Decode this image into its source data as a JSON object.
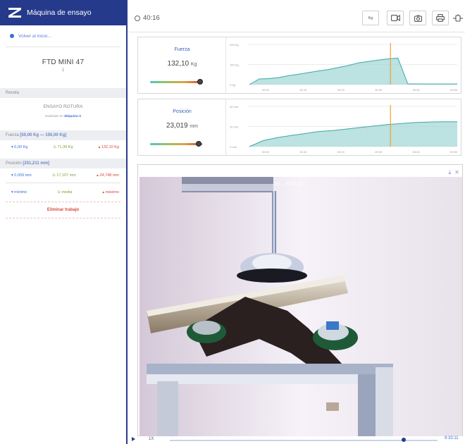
{
  "app": {
    "title": "Máquina de ensayo"
  },
  "sidebar": {
    "back": "Volver al inicio...",
    "machine_name": "FTD MINI 47",
    "machine_number": "1",
    "recipe_label": "Receta",
    "recipe_name": "ENSAYO ROTURA",
    "performed_prefix": "realizado en",
    "performed_machine": "Máquina A",
    "force_label": "Fuerza",
    "force_range": "[50,00 Kg — 150,00 Kg]",
    "force_min": "0,00 Kg",
    "force_avg": "71,36 Kg",
    "force_max": "132,10 Kg",
    "position_label": "Posición",
    "position_range": "[251,211 mm]",
    "position_min": "0,009 mm",
    "position_avg": "17,107 mm",
    "position_max": "24,748 mm",
    "legend_min": "mínimo",
    "legend_avg": "media",
    "legend_max": "máximo",
    "delete": "Eliminar trabajo"
  },
  "topbar": {
    "timer": "40:16",
    "unit_button": "Kg"
  },
  "force_panel": {
    "label": "Fuerza",
    "value": "132,10",
    "unit": "Kg",
    "level": 0.96
  },
  "position_panel": {
    "label": "Posición",
    "value": "23,019",
    "unit": "mm",
    "level": 0.93
  },
  "chart_data": [
    {
      "type": "area",
      "x": [
        "00:00",
        "00:10",
        "00:20",
        "00:30",
        "00:40",
        "00:50"
      ],
      "y_ticks": [
        "200 Kg",
        "100 Kg",
        "0 Kg"
      ],
      "ylim": [
        0,
        200
      ],
      "series": [
        {
          "values": [
            0,
            28,
            30,
            35,
            45,
            52,
            60,
            68,
            75,
            85,
            95,
            108,
            115,
            122,
            128,
            132,
            4,
            3,
            3,
            3,
            3,
            3
          ]
        }
      ],
      "marker_x": "00:33",
      "colors": {
        "fill": "#9fd6d4",
        "line": "#3aa8a8",
        "marker": "#f0a030"
      }
    },
    {
      "type": "area",
      "x": [
        "00:00",
        "00:10",
        "00:20",
        "00:30",
        "00:40",
        "00:50"
      ],
      "y_ticks": [
        "40 mm",
        "20 mm",
        "0 mm"
      ],
      "ylim": [
        0,
        40
      ],
      "series": [
        {
          "values": [
            0,
            6,
            9,
            11,
            13,
            15,
            16,
            17.5,
            19,
            20.5,
            22,
            23,
            24,
            24.5,
            24.7,
            24.7
          ]
        }
      ],
      "marker_x": "00:33",
      "colors": {
        "fill": "#9fd6d4",
        "line": "#3aa8a8",
        "marker": "#f0a030"
      }
    }
  ],
  "video": {
    "timestamp": "05/... 9:53:12"
  },
  "playbar": {
    "speed": "1X",
    "end_time": "9:33:11"
  }
}
